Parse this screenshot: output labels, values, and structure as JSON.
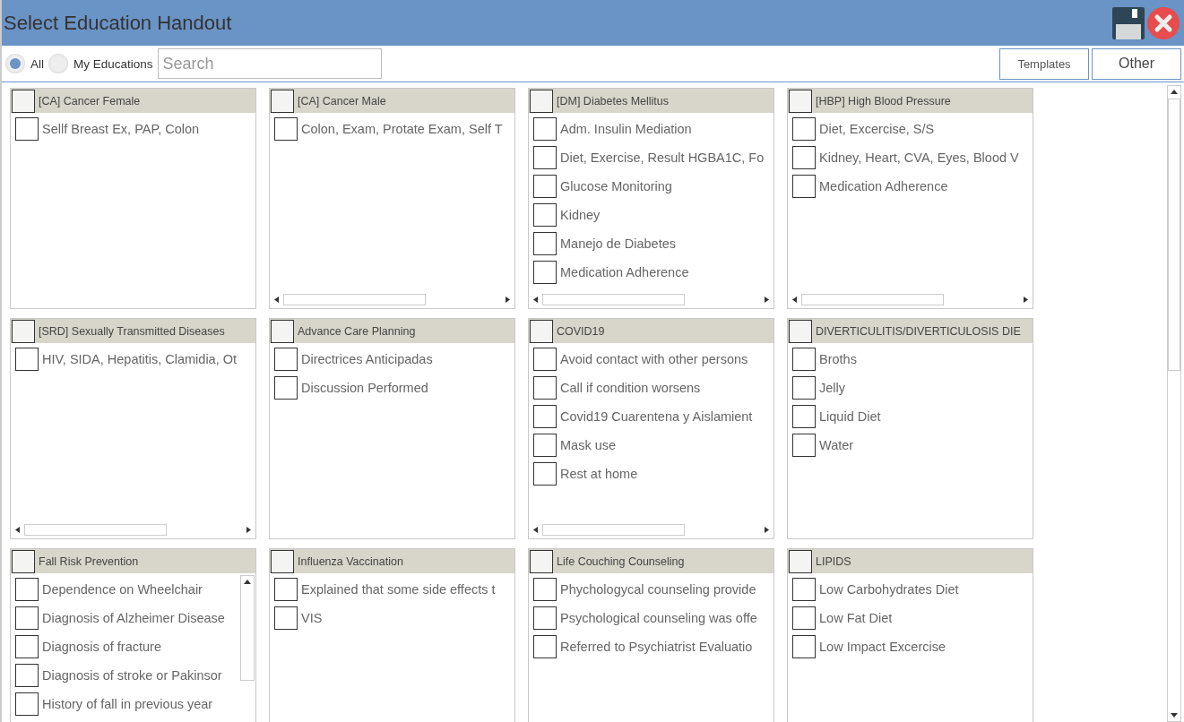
{
  "window": {
    "title": "Select Education Handout"
  },
  "filters": [
    {
      "label": "All",
      "selected": true
    },
    {
      "label": "My Educations",
      "selected": false
    }
  ],
  "search": {
    "placeholder": "Search"
  },
  "buttons": [
    "Templates",
    "Other"
  ],
  "panels": [
    {
      "title": "[CA] Cancer Female",
      "checked": false,
      "kind": "plain",
      "items": [
        {
          "label": "Sellf Breast Ex, PAP, Colon",
          "checked": false
        }
      ]
    },
    {
      "title": "[CA] Cancer Male",
      "checked": false,
      "kind": "wide",
      "items": [
        {
          "label": "Colon, Exam, Protate Exam, Self T",
          "checked": false
        }
      ]
    },
    {
      "title": "[DM] Diabetes Mellitus",
      "checked": false,
      "kind": "wide",
      "items": [
        {
          "label": "Adm. Insulin Mediation",
          "checked": false
        },
        {
          "label": "Diet, Exercise, Result HGBA1C, Fo",
          "checked": false
        },
        {
          "label": "Glucose Monitoring",
          "checked": false
        },
        {
          "label": "Kidney",
          "checked": false
        },
        {
          "label": "Manejo de Diabetes",
          "checked": false
        },
        {
          "label": "Medication Adherence",
          "checked": false
        }
      ]
    },
    {
      "title": "[HBP] High Blood Pressure",
      "checked": false,
      "kind": "wide",
      "items": [
        {
          "label": "Diet, Excercise, S/S",
          "checked": false
        },
        {
          "label": "Kidney, Heart, CVA, Eyes, Blood V",
          "checked": false
        },
        {
          "label": "Medication Adherence",
          "checked": false
        }
      ]
    },
    {
      "title": "[SRD] Sexually Transmitted Diseases",
      "checked": false,
      "kind": "wide",
      "items": [
        {
          "label": "HIV, SIDA, Hepatitis, Clamidia, Ot",
          "checked": false
        }
      ]
    },
    {
      "title": "Advance Care Planning",
      "checked": false,
      "kind": "plain",
      "items": [
        {
          "label": "Directrices Anticipadas",
          "checked": false
        },
        {
          "label": "Discussion Performed",
          "checked": false
        }
      ]
    },
    {
      "title": "COVID19",
      "checked": false,
      "kind": "wide",
      "items": [
        {
          "label": "Avoid contact with other persons",
          "checked": false
        },
        {
          "label": "Call if condition worsens",
          "checked": false
        },
        {
          "label": "Covid19 Cuarentena y Aislamient",
          "checked": false
        },
        {
          "label": "Mask use",
          "checked": false
        },
        {
          "label": "Rest at home",
          "checked": false
        }
      ]
    },
    {
      "title": "DIVERTICULITIS/DIVERTICULOSIS DIE",
      "checked": false,
      "kind": "plain",
      "items": [
        {
          "label": "Broths",
          "checked": false
        },
        {
          "label": "Jelly",
          "checked": false
        },
        {
          "label": "Liquid Diet",
          "checked": false
        },
        {
          "label": "Water",
          "checked": false
        }
      ]
    },
    {
      "title": "Fall Risk Prevention",
      "checked": false,
      "kind": "long",
      "items": [
        {
          "label": "Dependence on Wheelchair",
          "checked": false
        },
        {
          "label": "Diagnosis of Alzheimer Disease",
          "checked": false
        },
        {
          "label": "Diagnosis of fracture",
          "checked": false
        },
        {
          "label": "Diagnosis of stroke or Pakinsor",
          "checked": false
        },
        {
          "label": "History of fall in previous year",
          "checked": false
        }
      ]
    },
    {
      "title": "Influenza Vaccination",
      "checked": false,
      "kind": "plain",
      "items": [
        {
          "label": "Explained that some side effects t",
          "checked": false
        },
        {
          "label": "VIS",
          "checked": false
        }
      ]
    },
    {
      "title": "Life Couching Counseling",
      "checked": false,
      "kind": "plain",
      "items": [
        {
          "label": "Phychologycal counseling provide",
          "checked": false
        },
        {
          "label": "Psychological counseling was offe",
          "checked": false
        },
        {
          "label": "Referred to Psychiatrist Evaluatio",
          "checked": false
        }
      ]
    },
    {
      "title": "LIPIDS",
      "checked": false,
      "kind": "plain",
      "items": [
        {
          "label": "Low Carbohydrates Diet",
          "checked": false
        },
        {
          "label": "Low Fat Diet",
          "checked": false
        },
        {
          "label": "Low Impact Excercise",
          "checked": false
        }
      ]
    }
  ]
}
